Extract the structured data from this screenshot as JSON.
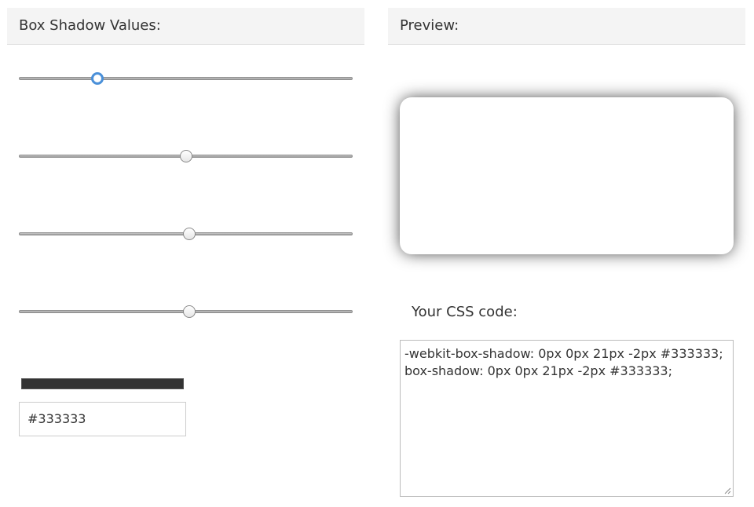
{
  "left_panel": {
    "title": "Box Shadow Values:",
    "sliders": [
      {
        "name": "horizontal-offset",
        "value": 0.235
      },
      {
        "name": "vertical-offset",
        "value": 0.5
      },
      {
        "name": "blur-radius",
        "value": 0.51
      },
      {
        "name": "spread-radius",
        "value": 0.51
      }
    ],
    "color_swatch": "#333333",
    "color_value": "#333333"
  },
  "right_panel": {
    "title": "Preview:",
    "css_label": "Your CSS code:",
    "css_lines": [
      "-webkit-box-shadow: 0px 0px 21px -2px #333333;",
      "box-shadow: 0px 0px 21px -2px #333333;"
    ]
  },
  "colors": {
    "header_bg": "#f4f4f4",
    "accent": "#4a90d9",
    "shadow": "#333333"
  }
}
